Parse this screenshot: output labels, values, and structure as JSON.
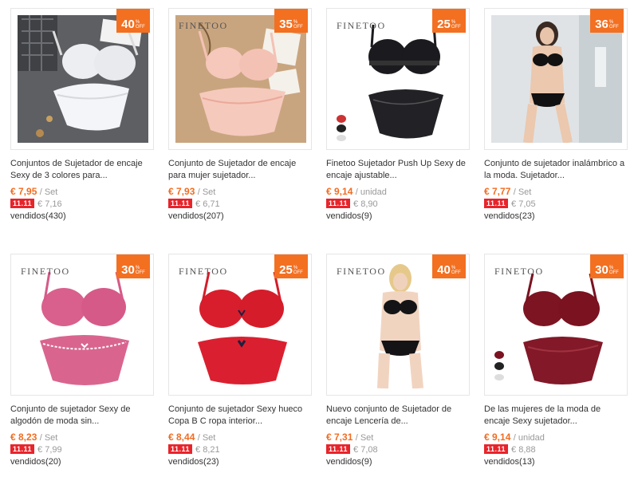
{
  "products": [
    {
      "title": "Conjuntos de Sujetador de encaje Sexy de 3 colores para...",
      "price": "€ 7,95",
      "unit": "/ Set",
      "promo_price": "€ 7,16",
      "sold": "vendidos(430)",
      "discount": "40",
      "brand": "",
      "photo": "white-bra-set"
    },
    {
      "title": "Conjunto de Sujetador de encaje para mujer sujetador...",
      "price": "€ 7,93",
      "unit": "/ Set",
      "promo_price": "€ 6,71",
      "sold": "vendidos(207)",
      "discount": "35",
      "brand": "FINETOO",
      "photo": "pink-bra-set"
    },
    {
      "title": "Finetoo Sujetador Push Up Sexy de encaje ajustable...",
      "price": "€ 9,14",
      "unit": "/ unidad",
      "promo_price": "€ 8,90",
      "sold": "vendidos(9)",
      "discount": "25",
      "brand": "FINETOO",
      "photo": "black-lace-bra-set"
    },
    {
      "title": "Conjunto de sujetador inalámbrico a la moda. Sujetador...",
      "price": "€ 7,77",
      "unit": "/ Set",
      "promo_price": "€ 7,05",
      "sold": "vendidos(23)",
      "discount": "36",
      "brand": "",
      "photo": "model-black-set"
    },
    {
      "title": "Conjunto de sujetador Sexy de algodón de moda sin...",
      "price": "€ 8,23",
      "unit": "/ Set",
      "promo_price": "€ 7,99",
      "sold": "vendidos(20)",
      "discount": "30",
      "brand": "FINETOO",
      "photo": "rose-bra-set"
    },
    {
      "title": "Conjunto de sujetador Sexy hueco Copa B C ropa interior...",
      "price": "€ 8,44",
      "unit": "/ Set",
      "promo_price": "€ 8,21",
      "sold": "vendidos(23)",
      "discount": "25",
      "brand": "FINETOO",
      "photo": "red-bra-set"
    },
    {
      "title": "Nuevo conjunto de Sujetador de encaje Lencería de...",
      "price": "€ 7,31",
      "unit": "/ Set",
      "promo_price": "€ 7,08",
      "sold": "vendidos(9)",
      "discount": "40",
      "brand": "FINETOO",
      "photo": "model-black-set"
    },
    {
      "title": "De las mujeres de la moda de encaje Sexy sujetador...",
      "price": "€ 9,14",
      "unit": "/ unidad",
      "promo_price": "€ 8,88",
      "sold": "vendidos(13)",
      "discount": "30",
      "brand": "FINETOO",
      "photo": "wine-lace-bra-set"
    }
  ],
  "promo_label": "11.11",
  "off_label": [
    "%",
    "OFF"
  ],
  "colors": {
    "accent": "#f37021",
    "price": "#f36c21",
    "promo": "#e8242b"
  }
}
